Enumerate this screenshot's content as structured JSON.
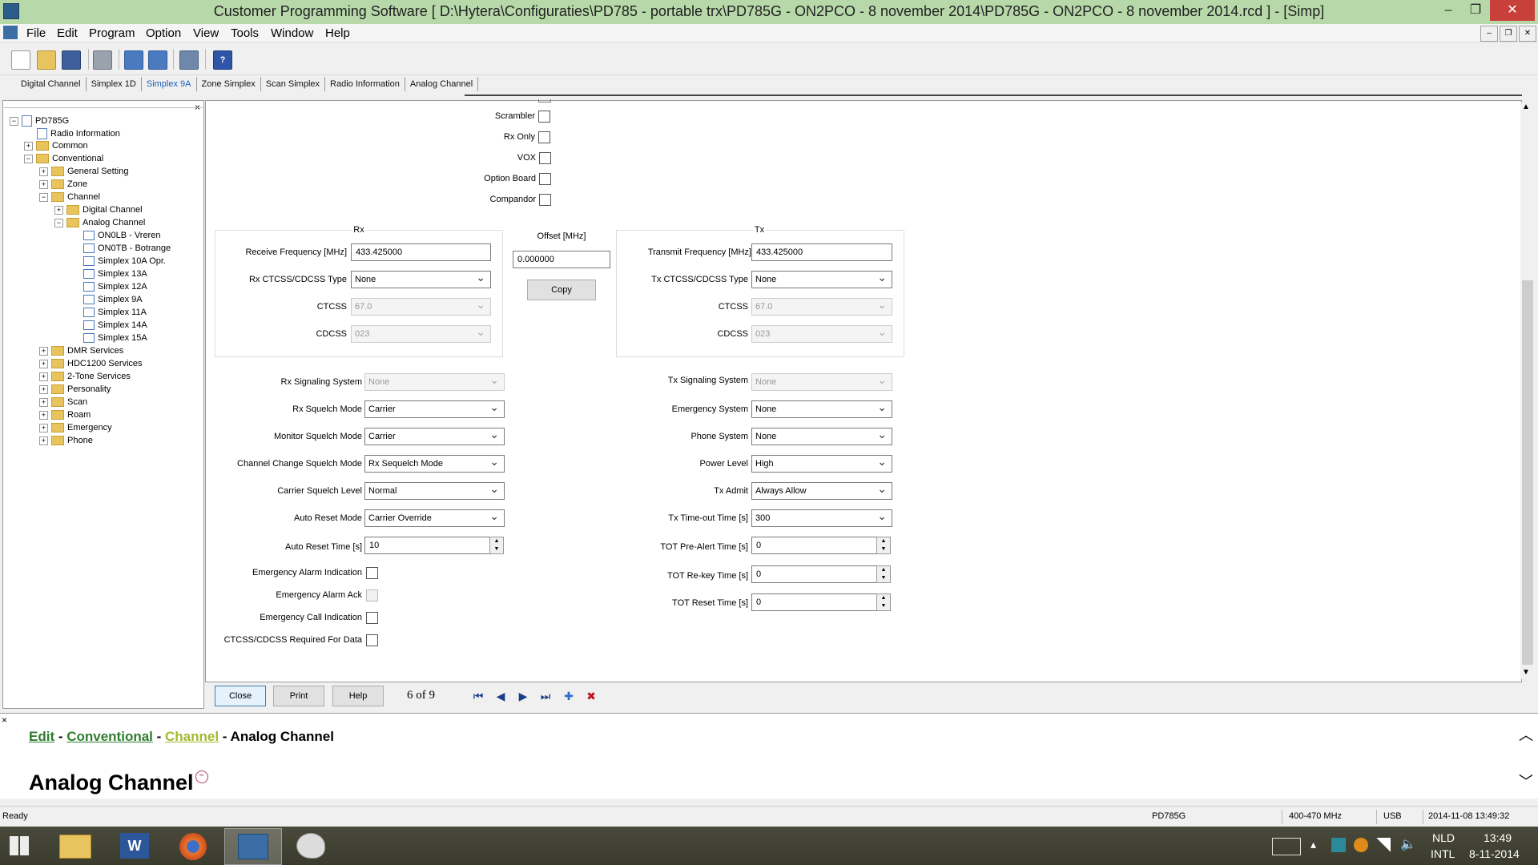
{
  "window": {
    "title": "Customer Programming Software [ D:\\Hytera\\Configuraties\\PD785 - portable trx\\PD785G - ON2PCO - 8 november 2014\\PD785G - ON2PCO - 8 november 2014.rcd ] - [Simp]",
    "minimize": "–",
    "maximize": "❐",
    "close": "✕"
  },
  "menu": {
    "items": [
      "File",
      "Edit",
      "Program",
      "Option",
      "View",
      "Tools",
      "Window",
      "Help"
    ],
    "mdi_minimize": "–",
    "mdi_restore": "❐",
    "mdi_close": "✕"
  },
  "tabs": [
    "Digital Channel",
    "Simplex 1D",
    "Simplex 9A",
    "Zone Simplex",
    "Scan Simplex",
    "Radio Information",
    "Analog Channel"
  ],
  "tree": {
    "close": "×",
    "root": "PD785G",
    "radio_information": "Radio Information",
    "common": "Common",
    "conventional": "Conventional",
    "general_setting": "General Setting",
    "zone": "Zone",
    "channel": "Channel",
    "digital_channel": "Digital Channel",
    "analog_channel": "Analog Channel",
    "ch1": "ON0LB - Vreren",
    "ch2": "ON0TB - Botrange",
    "ch3": "Simplex 10A Opr.",
    "ch4": "Simplex 13A",
    "ch5": "Simplex 12A",
    "ch6": "Simplex 9A",
    "ch7": "Simplex 11A",
    "ch8": "Simplex 14A",
    "ch9": "Simplex 15A",
    "dmr_services": "DMR Services",
    "hdc1200": "HDC1200 Services",
    "two_tone": "2-Tone Services",
    "personality": "Personality",
    "scan": "Scan",
    "roam": "Roam",
    "emergency": "Emergency",
    "phone": "Phone",
    "expand": "+",
    "collapse": "−"
  },
  "form": {
    "scrambler": "Scrambler",
    "rx_only": "Rx Only",
    "vox": "VOX",
    "option_board": "Option Board",
    "compandor": "Compandor",
    "rx_group": "Rx",
    "tx_group": "Tx",
    "offset_label": "Offset [MHz]",
    "offset_value": "0.000000",
    "copy": "Copy",
    "receive_freq_label": "Receive Frequency [MHz]",
    "receive_freq": "433.425000",
    "rx_ctcss_type_label": "Rx CTCSS/CDCSS Type",
    "rx_ctcss_type": "None",
    "rx_ctcss_label": "CTCSS",
    "rx_ctcss": "67.0",
    "rx_cdcss_label": "CDCSS",
    "rx_cdcss": "023",
    "transmit_freq_label": "Transmit Frequency [MHz]",
    "transmit_freq": "433.425000",
    "tx_ctcss_type_label": "Tx CTCSS/CDCSS Type",
    "tx_ctcss_type": "None",
    "tx_ctcss_label": "CTCSS",
    "tx_ctcss": "67.0",
    "tx_cdcss_label": "CDCSS",
    "tx_cdcss": "023",
    "rx_signaling_label": "Rx Signaling System",
    "rx_signaling": "None",
    "rx_squelch_label": "Rx Squelch Mode",
    "rx_squelch": "Carrier",
    "monitor_squelch_label": "Monitor Squelch Mode",
    "monitor_squelch": "Carrier",
    "ch_change_squelch_label": "Channel Change Squelch Mode",
    "ch_change_squelch": "Rx Sequelch Mode",
    "carrier_level_label": "Carrier Squelch Level",
    "carrier_level": "Normal",
    "auto_reset_mode_label": "Auto Reset Mode",
    "auto_reset_mode": "Carrier Override",
    "auto_reset_time_label": "Auto Reset Time [s]",
    "auto_reset_time": "10",
    "emerg_alarm_ind": "Emergency Alarm Indication",
    "emerg_alarm_ack": "Emergency Alarm Ack",
    "emerg_call_ind": "Emergency Call Indication",
    "ctcss_req_data": "CTCSS/CDCSS Required For Data",
    "tx_signaling_label": "Tx Signaling System",
    "tx_signaling": "None",
    "emergency_system_label": "Emergency System",
    "emergency_system": "None",
    "phone_system_label": "Phone System",
    "phone_system": "None",
    "power_level_label": "Power Level",
    "power_level": "High",
    "tx_admit_label": "Tx Admit",
    "tx_admit": "Always Allow",
    "tot_label": "Tx Time-out Time [s]",
    "tot": "300",
    "tot_prealert_label": "TOT Pre-Alert Time [s]",
    "tot_prealert": "0",
    "tot_rekey_label": "TOT Re-key Time [s]",
    "tot_rekey": "0",
    "tot_reset_label": "TOT Reset Time [s]",
    "tot_reset": "0",
    "spin_up": "▲",
    "spin_down": "▼"
  },
  "footer": {
    "close": "Close",
    "print": "Print",
    "help": "Help",
    "page": "6 of 9",
    "first": "⏮",
    "prev": "◀",
    "next": "▶",
    "last": "⏭",
    "add": "✚",
    "delete": "✖"
  },
  "help": {
    "close": "×",
    "crumb_edit": "Edit",
    "crumb_conventional": "Conventional",
    "crumb_channel": "Channel",
    "crumb_current": "Analog Channel",
    "sep": " - ",
    "title": "Analog Channel",
    "scroll_up": "︿",
    "scroll_down": "﹀"
  },
  "status": {
    "left": "Ready",
    "model": "PD785G",
    "band": "400-470 MHz",
    "port": "USB",
    "datetime": "2014-11-08 13:49:32"
  },
  "taskbar": {
    "lang1": "NLD",
    "lang2": "INTL",
    "time": "13:49",
    "date": "8-11-2014"
  },
  "colors": {
    "titlebar": "#b7d9a9",
    "crumb_green": "#2e7d2e",
    "crumb_channel": "#a5b82e"
  }
}
